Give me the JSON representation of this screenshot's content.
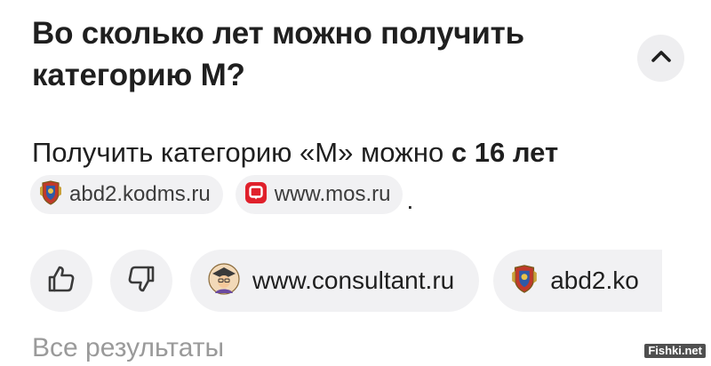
{
  "question": {
    "text": "Во сколько лет можно получить категорию М?"
  },
  "answer": {
    "text_before": "Получить категорию «М» можно ",
    "text_bold": "с 16 лет",
    "period": "."
  },
  "sources": [
    {
      "label": "abd2.kodms.ru",
      "icon": "coat-of-arms-icon"
    },
    {
      "label": "www.mos.ru",
      "icon": "mos-ru-icon",
      "icon_color": "#e0202b"
    }
  ],
  "actions": {
    "like_icon": "thumbs-up-icon",
    "dislike_icon": "thumbs-down-icon",
    "links": [
      {
        "label": "www.consultant.ru",
        "icon": "consultant-avatar-icon"
      },
      {
        "label": "abd2.ko",
        "icon": "coat-of-arms-icon"
      }
    ]
  },
  "footer": {
    "all_results": "Все результаты",
    "watermark": "Fishki.net"
  },
  "colors": {
    "text": "#1f1f1f",
    "chip_bg": "#f1f1f3",
    "muted": "#9a9a9a",
    "mos_red": "#e0202b"
  }
}
